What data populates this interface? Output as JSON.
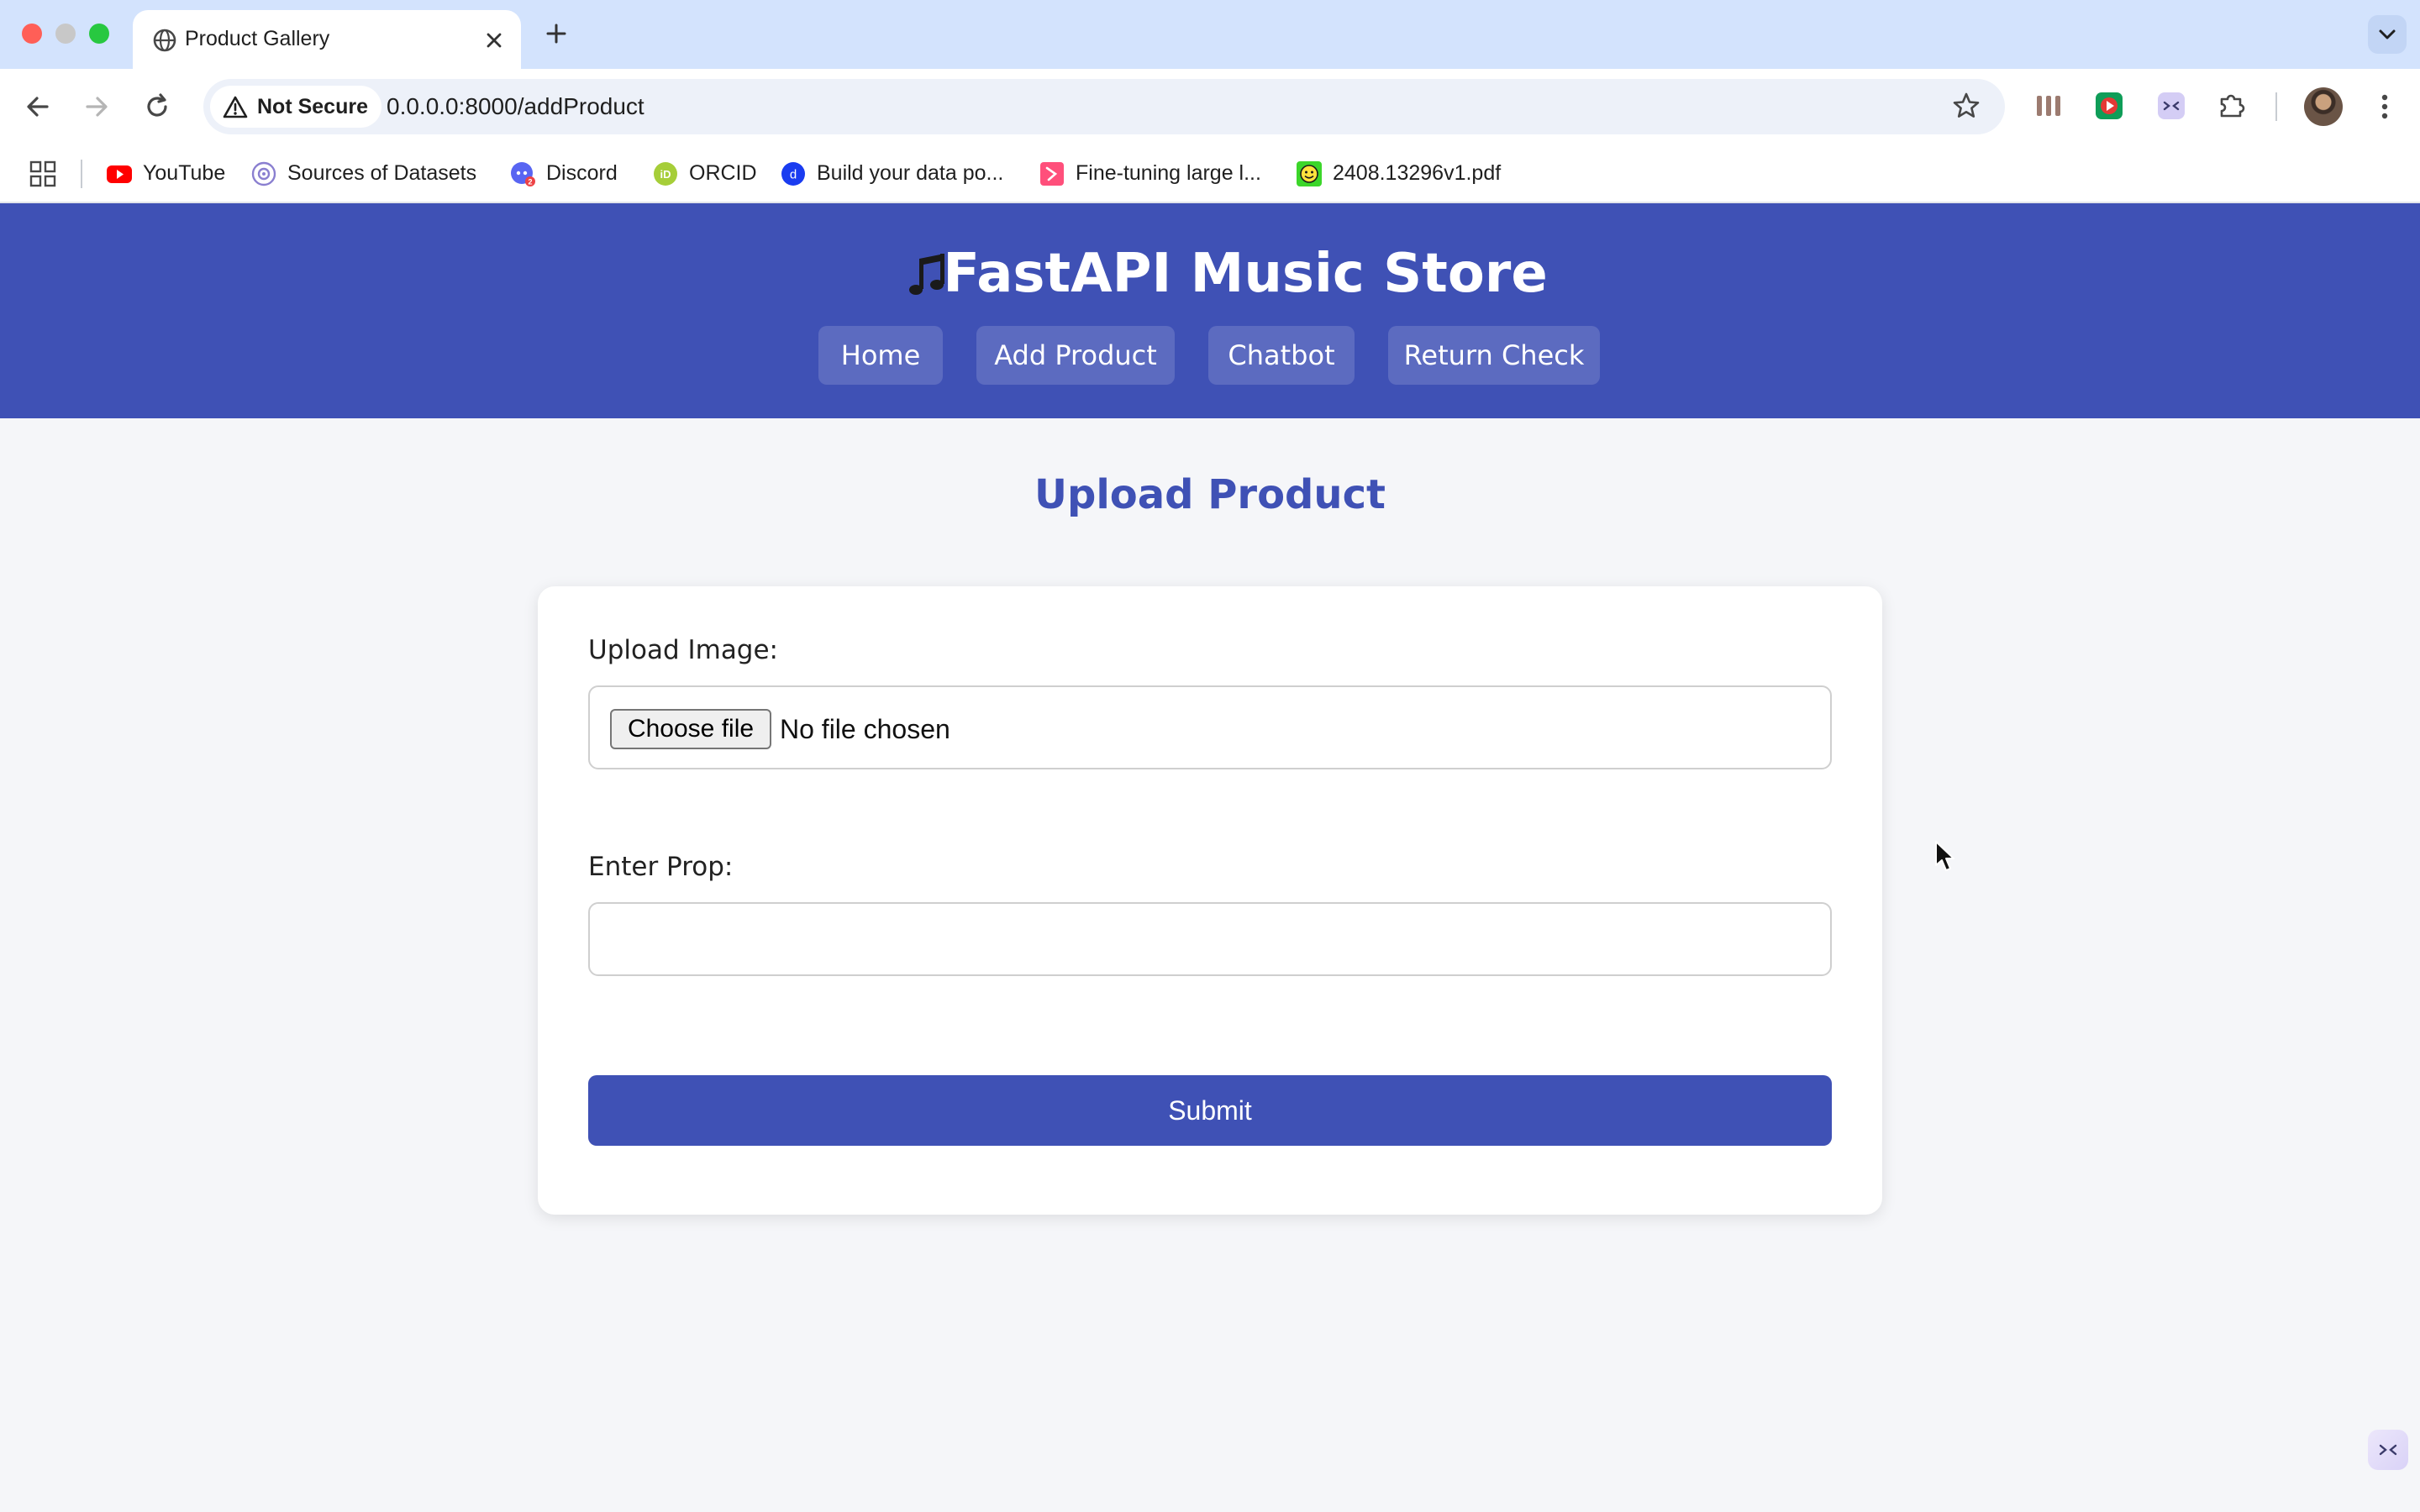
{
  "browser": {
    "tab_title": "Product Gallery",
    "security_label": "Not Secure",
    "url": "0.0.0.0:8000/addProduct",
    "bookmarks": [
      {
        "label": "YouTube",
        "icon": "youtube-icon",
        "color": "#ff0000"
      },
      {
        "label": "Sources of Datasets",
        "icon": "datasets-icon",
        "color": "#8a7fd0"
      },
      {
        "label": "Discord",
        "icon": "discord-icon",
        "color": "#5865f2"
      },
      {
        "label": "ORCID",
        "icon": "orcid-icon",
        "color": "#a6ce39"
      },
      {
        "label": "Build your data po...",
        "icon": "data-portal-icon",
        "color": "#1a3cf0"
      },
      {
        "label": "Fine-tuning large l...",
        "icon": "fine-tuning-icon",
        "color": "#ff4f7b"
      },
      {
        "label": "2408.13296v1.pdf",
        "icon": "pdf-smiley-icon",
        "color": "#3cd62a"
      }
    ]
  },
  "site": {
    "title": "FastAPI Music Store",
    "title_icon": "musical-note-icon",
    "accent_color": "#3f51b5",
    "nav": [
      {
        "label": "Home"
      },
      {
        "label": "Add Product"
      },
      {
        "label": "Chatbot"
      },
      {
        "label": "Return Check"
      }
    ]
  },
  "form": {
    "heading": "Upload Product",
    "image_label": "Upload Image:",
    "choose_file_label": "Choose file",
    "file_status": "No file chosen",
    "prop_label": "Enter Prop:",
    "prop_value": "",
    "prop_placeholder": "",
    "submit_label": "Submit"
  }
}
